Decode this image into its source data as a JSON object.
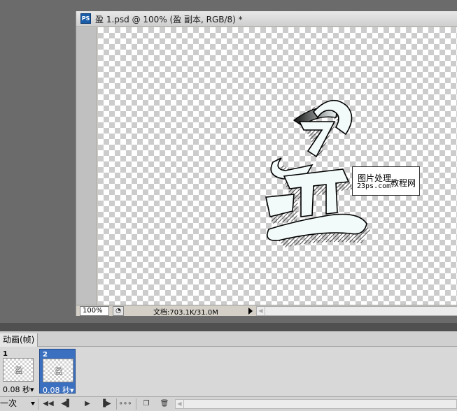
{
  "document": {
    "app_icon": "PS",
    "title": "盈 1.psd @ 100% (盈 副本, RGB/8) *",
    "zoom": "100%",
    "doc_size": "文档:703.1K/31.0M",
    "watermark": {
      "line1": "图片处理",
      "line2": "23ps.com",
      "line3": "教程网"
    },
    "artwork_char": "盈"
  },
  "animation_panel": {
    "tab_label": "动画(帧)",
    "frames": [
      {
        "number": "1",
        "delay": "0.08 秒▾",
        "selected": false
      },
      {
        "number": "2",
        "delay": "0.08 秒▾",
        "selected": true
      }
    ],
    "loop_option": "一次",
    "toolbar_icons": [
      "first-frame-icon",
      "previous-frame-icon",
      "play-icon",
      "next-frame-icon",
      "tween-icon",
      "duplicate-frame-icon",
      "delete-frame-icon"
    ]
  }
}
